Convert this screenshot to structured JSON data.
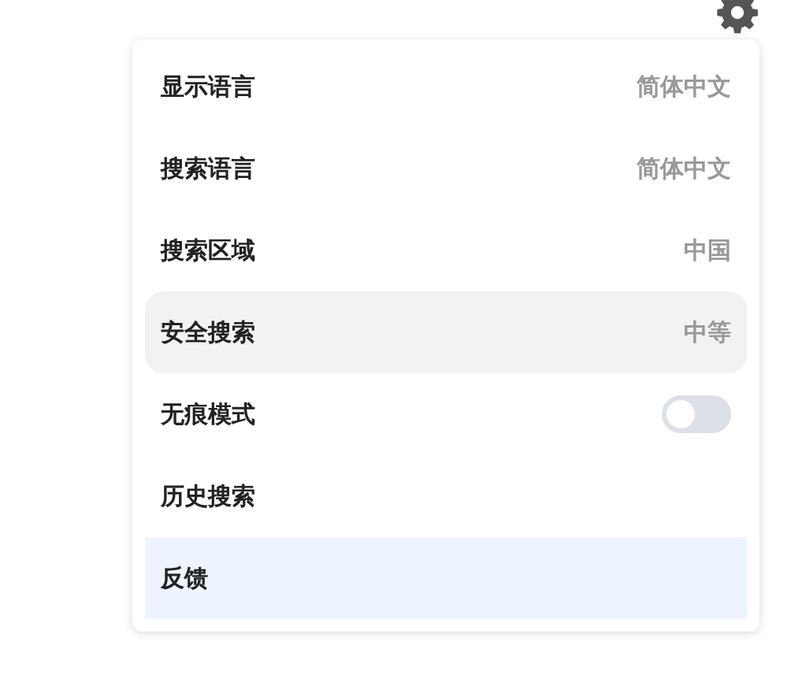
{
  "menu": {
    "items": [
      {
        "kind": "value",
        "label": "显示语言",
        "value": "简体中文",
        "hovered": false,
        "selected": false
      },
      {
        "kind": "value",
        "label": "搜索语言",
        "value": "简体中文",
        "hovered": false,
        "selected": false
      },
      {
        "kind": "value",
        "label": "搜索区域",
        "value": "中国",
        "hovered": false,
        "selected": false
      },
      {
        "kind": "value",
        "label": "安全搜索",
        "value": "中等",
        "hovered": true,
        "selected": false
      },
      {
        "kind": "toggle",
        "label": "无痕模式",
        "on": false,
        "hovered": false,
        "selected": false
      },
      {
        "kind": "plain",
        "label": "历史搜索",
        "hovered": false,
        "selected": false
      },
      {
        "kind": "plain",
        "label": "反馈",
        "hovered": false,
        "selected": true
      }
    ]
  }
}
